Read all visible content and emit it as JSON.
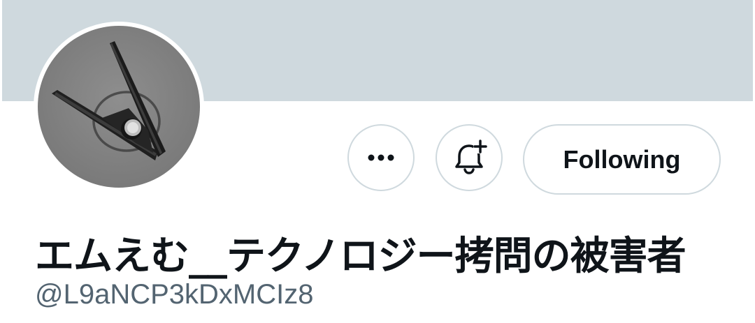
{
  "profile": {
    "display_name": "エムえむ__テクノロジー拷問の被害者",
    "handle": "@L9aNCP3kDxMCIz8"
  },
  "actions": {
    "more_icon": "more-horizontal-icon",
    "notifications_icon": "bell-plus-icon",
    "follow_label": "Following"
  },
  "colors": {
    "banner": "#cfd9de",
    "border": "#cfd9de",
    "text_primary": "#0f1419",
    "text_secondary": "#536471"
  }
}
